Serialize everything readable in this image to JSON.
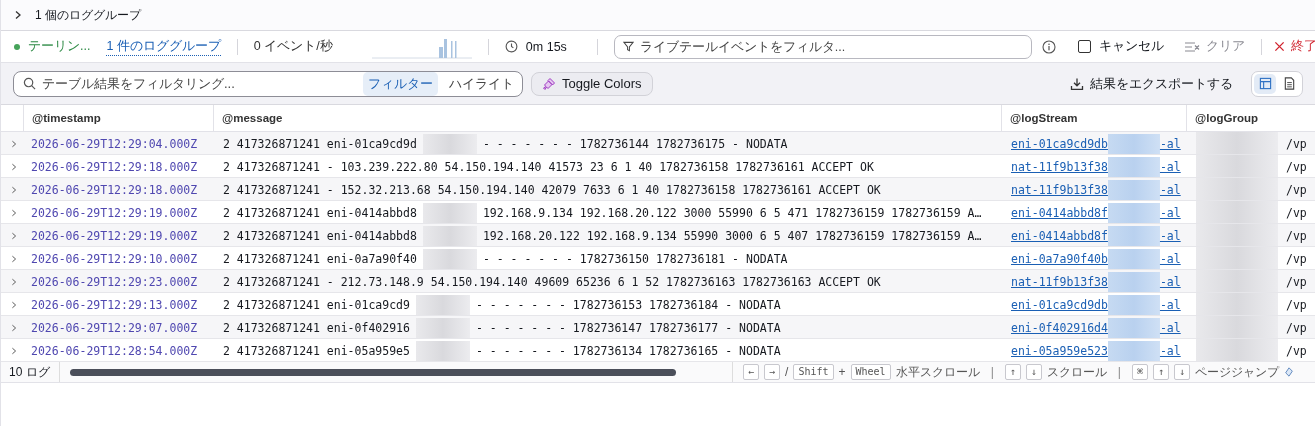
{
  "header": {
    "expanded": false,
    "title": "1 個のロググループ"
  },
  "live_tail": {
    "status": "テーリン...",
    "log_groups_link": "1 件のロググループ",
    "rate": "0 イベント/秒",
    "elapsed": "0m 15s",
    "filter": {
      "placeholder": "ライブテールイベントをフィルタ..."
    },
    "cancel": {
      "label": "キャンセル",
      "checked": false
    },
    "clear": {
      "label": "クリア",
      "disabled": true
    },
    "stop": "終了"
  },
  "results_toolbar": {
    "search": {
      "placeholder": "テーブル結果をフィルタリング..."
    },
    "modes": [
      {
        "label": "フィルター",
        "selected": true
      },
      {
        "label": "ハイライト",
        "selected": false
      }
    ],
    "toggle_colors": "Toggle Colors",
    "export": "結果をエクスポートする",
    "views": [
      {
        "kind": "table",
        "selected": true
      },
      {
        "kind": "text",
        "selected": false
      }
    ]
  },
  "table": {
    "columns": [
      "@timestamp",
      "@message",
      "@logStream",
      "@logGroup"
    ],
    "rows": [
      {
        "timestamp": "2026-06-29T12:29:04.000Z",
        "message_parts": [
          "2 417326871241 eni-01ca9cd9d",
          "- - - - - - - 1782736144 1782736175 - NODATA"
        ],
        "log_stream": [
          "eni-01ca9cd9db",
          "-al"
        ],
        "column_5": "/vp"
      },
      {
        "timestamp": "2026-06-29T12:29:18.000Z",
        "message_parts": [
          "2 417326871241 - 103.239.222.80 54.150.194.140 41573 23 6 1 40 1782736158 1782736161 ACCEPT OK"
        ],
        "log_stream": [
          "nat-11f9b13f38",
          "-al"
        ],
        "column_5": "/vp"
      },
      {
        "timestamp": "2026-06-29T12:29:18.000Z",
        "message_parts": [
          "2 417326871241 - 152.32.213.68 54.150.194.140 42079 7633 6 1 40 1782736158 1782736161 ACCEPT OK"
        ],
        "log_stream": [
          "nat-11f9b13f38",
          "-al"
        ],
        "column_5": "/vp"
      },
      {
        "timestamp": "2026-06-29T12:29:19.000Z",
        "message_parts": [
          "2 417326871241 eni-0414abbd8",
          "192.168.9.134 192.168.20.122 3000 55990 6 5 471 1782736159 1782736159 A…"
        ],
        "log_stream": [
          "eni-0414abbd8f",
          "-al"
        ],
        "column_5": "/vp"
      },
      {
        "timestamp": "2026-06-29T12:29:19.000Z",
        "message_parts": [
          "2 417326871241 eni-0414abbd8",
          "192.168.20.122 192.168.9.134 55990 3000 6 5 407 1782736159 1782736159 A…"
        ],
        "log_stream": [
          "eni-0414abbd8f",
          "-al"
        ],
        "column_5": "/vp"
      },
      {
        "timestamp": "2026-06-29T12:29:10.000Z",
        "message_parts": [
          "2 417326871241 eni-0a7a90f40",
          "- - - - - - - 1782736150 1782736181 - NODATA"
        ],
        "log_stream": [
          "eni-0a7a90f40b",
          "-al"
        ],
        "column_5": "/vp"
      },
      {
        "timestamp": "2026-06-29T12:29:23.000Z",
        "message_parts": [
          "2 417326871241 - 212.73.148.9 54.150.194.140 49609 65236 6 1 52 1782736163 1782736163 ACCEPT OK"
        ],
        "log_stream": [
          "nat-11f9b13f38",
          "-al"
        ],
        "column_5": "/vp"
      },
      {
        "timestamp": "2026-06-29T12:29:13.000Z",
        "message_parts": [
          "2 417326871241 eni-01ca9cd9",
          "- - - - - - - 1782736153 1782736184 - NODATA"
        ],
        "log_stream": [
          "eni-01ca9cd9db",
          "-al"
        ],
        "column_5": "/vp"
      },
      {
        "timestamp": "2026-06-29T12:29:07.000Z",
        "message_parts": [
          "2 417326871241 eni-0f402916",
          "- - - - - - - 1782736147 1782736177 - NODATA"
        ],
        "log_stream": [
          "eni-0f402916d4",
          "-al"
        ],
        "column_5": "/vp"
      },
      {
        "timestamp": "2026-06-29T12:28:54.000Z",
        "message_parts": [
          "2 417326871241 eni-05a959e5",
          "- - - - - - - 1782736134 1782736165 - NODATA"
        ],
        "log_stream": [
          "eni-05a959e523",
          "-al"
        ],
        "column_5": "/vp"
      }
    ]
  },
  "footer": {
    "count": "10 ログ",
    "hints": [
      {
        "kind": "key",
        "text": "←"
      },
      {
        "kind": "key",
        "text": "→"
      },
      {
        "kind": "sep",
        "text": "/"
      },
      {
        "kind": "key",
        "text": "Shift"
      },
      {
        "kind": "sep",
        "text": "+"
      },
      {
        "kind": "key",
        "text": "Wheel"
      },
      {
        "kind": "label",
        "text": "水平スクロール"
      },
      {
        "kind": "bar",
        "text": "|"
      },
      {
        "kind": "key",
        "text": "↑"
      },
      {
        "kind": "key",
        "text": "↓"
      },
      {
        "kind": "label",
        "text": "スクロール"
      },
      {
        "kind": "bar",
        "text": "|"
      },
      {
        "kind": "key",
        "text": "⌘"
      },
      {
        "kind": "key",
        "text": "↑"
      },
      {
        "kind": "key",
        "text": "↓"
      },
      {
        "kind": "label",
        "text": "ページジャンプ"
      }
    ]
  }
}
